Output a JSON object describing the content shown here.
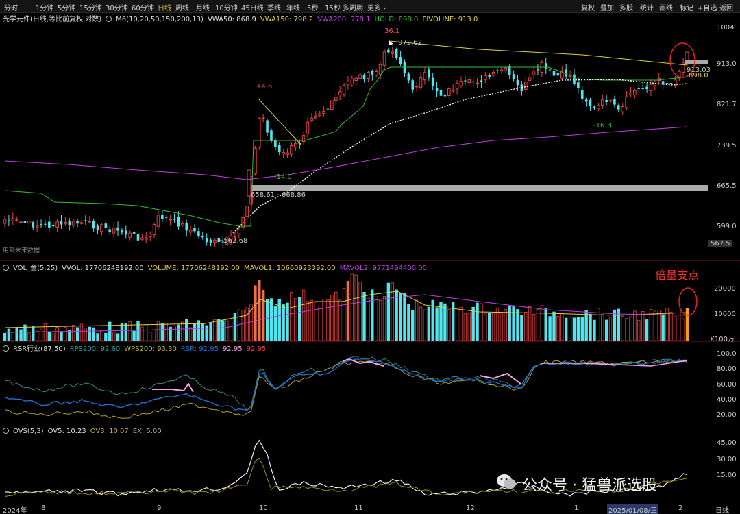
{
  "toolbar": {
    "left": [
      "分时",
      "1分钟",
      "5分钟",
      "15分钟",
      "30分钟",
      "60分钟",
      "日线",
      "周线",
      "月线",
      "10分钟",
      "45日线",
      "季线",
      "年线",
      "5秒",
      "15秒",
      "多周期",
      "更多 ›"
    ],
    "active_index": 6,
    "right": [
      "复权",
      "叠加",
      "多股",
      "统计",
      "画线",
      "标记",
      "+自选",
      "返回"
    ]
  },
  "main_panel": {
    "title": "光学元件(日线,等比前复权,对数)",
    "indicator": "M6(10,20,50,150,200,13)",
    "vwa50": "VWA50: 868.9",
    "vwa150": "VWA150: 798.2",
    "vwa200": "VWA200: 778.1",
    "hold": "HOLD: 898.0",
    "pivoline": "PIVOLINE: 913.0",
    "y_ticks": [
      "1004",
      "913.0",
      "821.7",
      "739.5",
      "665.5",
      "599.0"
    ],
    "current_price": "567.5",
    "future_note": "用到未来数据",
    "annotations": {
      "low": "562.68",
      "range": "658.61 - 668.86",
      "peak1": "44.6",
      "dip1": "-14.0",
      "peak2": "36.1",
      "high": "972.62",
      "dip2": "-16.3",
      "right_hi": "913.03",
      "right_lo": "898.0"
    }
  },
  "vol_panel": {
    "title": "VOL_金(5,25)",
    "vvol": "VVOL: 17706248192.00",
    "volume": "VOLUME: 17706248192.00",
    "mavol1": "MAVOL1: 10660923392.00",
    "mavol2": "MAVOL2: 9771494400.00",
    "y_ticks": [
      "20000",
      "10000"
    ],
    "unit": "X100万",
    "note": "倍量支点"
  },
  "rsr_panel": {
    "title": "RSR行业(87,50)",
    "rps200": "RPS200: 92.60",
    "wps200": "WPS200: 93.30",
    "rsr": "RSR: 92.95",
    "v1": "92.95",
    "v2": "92.95",
    "y_ticks": [
      "100.0",
      "80.00",
      "60.00",
      "40.00",
      "20.00"
    ]
  },
  "ovs_panel": {
    "title": "OVS(5,3)",
    "ov5": "OV5: 10.23",
    "ov3": "OV3: 10.07",
    "ex": "EX: 5.00",
    "y_ticks": [
      "45.00",
      "30.00",
      "15.00"
    ]
  },
  "x_axis": {
    "labels": [
      "2024年",
      "8",
      "9",
      "10",
      "11",
      "12",
      "1",
      "2025/01/08/三",
      "2"
    ],
    "period": "日线"
  },
  "watermark": "公众号 · 猛兽派选股",
  "colors": {
    "up": "#e84040",
    "down": "#50e6f0",
    "yellow": "#e0d040",
    "magenta": "#c040e0",
    "green": "#30c030",
    "white": "#f0f0f0",
    "orange": "#f07040",
    "rps": "#2c8c8c",
    "rsr": "#2070d0",
    "pink": "#f8a0e0"
  }
}
